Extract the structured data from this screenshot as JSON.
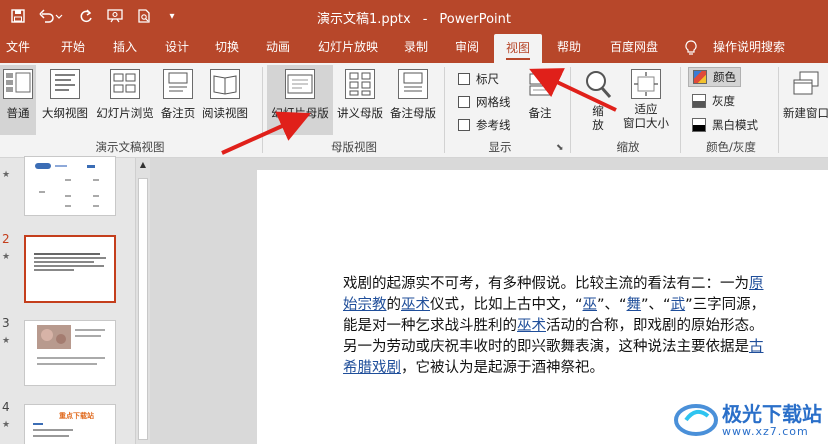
{
  "titlebar": {
    "document": "演示文稿1.pptx",
    "separator": "-",
    "app": "PowerPoint"
  },
  "tabs": [
    "文件",
    "开始",
    "插入",
    "设计",
    "切换",
    "动画",
    "幻灯片放映",
    "录制",
    "审阅",
    "视图",
    "帮助",
    "百度网盘",
    "操作说明搜索"
  ],
  "active_tab": "视图",
  "ribbon": {
    "presentation_views": {
      "label": "演示文稿视图",
      "buttons": [
        "普通",
        "大纲视图",
        "幻灯片浏览",
        "备注页",
        "阅读视图"
      ]
    },
    "master_views": {
      "label": "母版视图",
      "buttons": [
        "幻灯片母版",
        "讲义母版",
        "备注母版"
      ]
    },
    "show": {
      "label": "显示",
      "checkboxes": [
        "标尺",
        "网格线",
        "参考线"
      ],
      "notes": "备注"
    },
    "zoom": {
      "label": "缩放",
      "zoom_btn_line1": "缩",
      "zoom_btn_line2": "放",
      "fit_line1": "适应",
      "fit_line2": "窗口大小"
    },
    "color": {
      "label": "颜色/灰度",
      "options": [
        "颜色",
        "灰度",
        "黑白模式"
      ]
    },
    "window": {
      "new_window": "新建窗口"
    }
  },
  "slides": [
    {
      "number": "",
      "star": "★"
    },
    {
      "number": "2",
      "star": "★"
    },
    {
      "number": "3",
      "star": "★"
    },
    {
      "number": "4",
      "star": "★"
    }
  ],
  "thumb4_title": "重点下载站",
  "slide_text": {
    "l1_a": "戏剧的起源实不可考，有多种假说。比较主流的看法有二：一为",
    "l1_link": "原",
    "l2_a": "始宗教",
    "l2_b": "的",
    "l2_link2": "巫术",
    "l2_c": "仪式，比如上古中文，“",
    "l2_w1": "巫",
    "l2_d": "”、“",
    "l2_w2": "舞",
    "l2_e": "”、“",
    "l2_w3": "武",
    "l2_f": "”三字同源，",
    "l3_a": "能是对一种乞求战斗胜利的",
    "l3_link": "巫术",
    "l3_b": "活动的合称，即戏剧的原始形态。",
    "l4_a": "另一为劳动或庆祝丰收时的即兴歌舞表演，这种说法主要依据是",
    "l4_link": "古",
    "l5_link": "希腊戏剧",
    "l5_b": "，它被认为是起源于酒神祭祀。"
  },
  "watermark": {
    "name": "极光下载站",
    "url": "www.xz7.com"
  },
  "colors": {
    "accent": "#b7472a",
    "arrow": "#e0201a",
    "link": "#1f4e9a"
  }
}
